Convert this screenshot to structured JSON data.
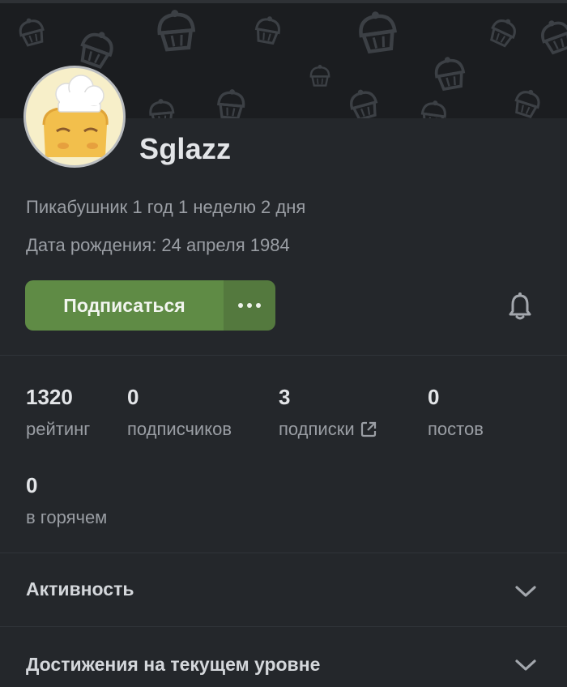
{
  "profile": {
    "username": "Sglazz",
    "tenure": "Пикабушник 1 год 1 неделю 2 дня",
    "birthday": "Дата рождения: 24 апреля 1984"
  },
  "actions": {
    "subscribe_label": "Подписаться",
    "more_icon": "more-dots-icon",
    "bell_icon": "bell-icon"
  },
  "stats": [
    {
      "value": "1320",
      "label": "рейтинг"
    },
    {
      "value": "0",
      "label": "подписчиков"
    },
    {
      "value": "3",
      "label": "подписки",
      "icon": "external-link-icon"
    },
    {
      "value": "0",
      "label": "постов"
    },
    {
      "value": "0",
      "label": "в горячем"
    }
  ],
  "sections": [
    {
      "title": "Активность",
      "icon": "chevron-down-icon"
    },
    {
      "title": "Достижения на текущем уровне",
      "icon": "chevron-down-icon"
    }
  ],
  "colors": {
    "background": "#24272b",
    "cover": "#1b1d20",
    "accent_green": "#5f8b45",
    "text_primary": "#e3e5e8",
    "text_secondary": "#9a9ea4"
  }
}
